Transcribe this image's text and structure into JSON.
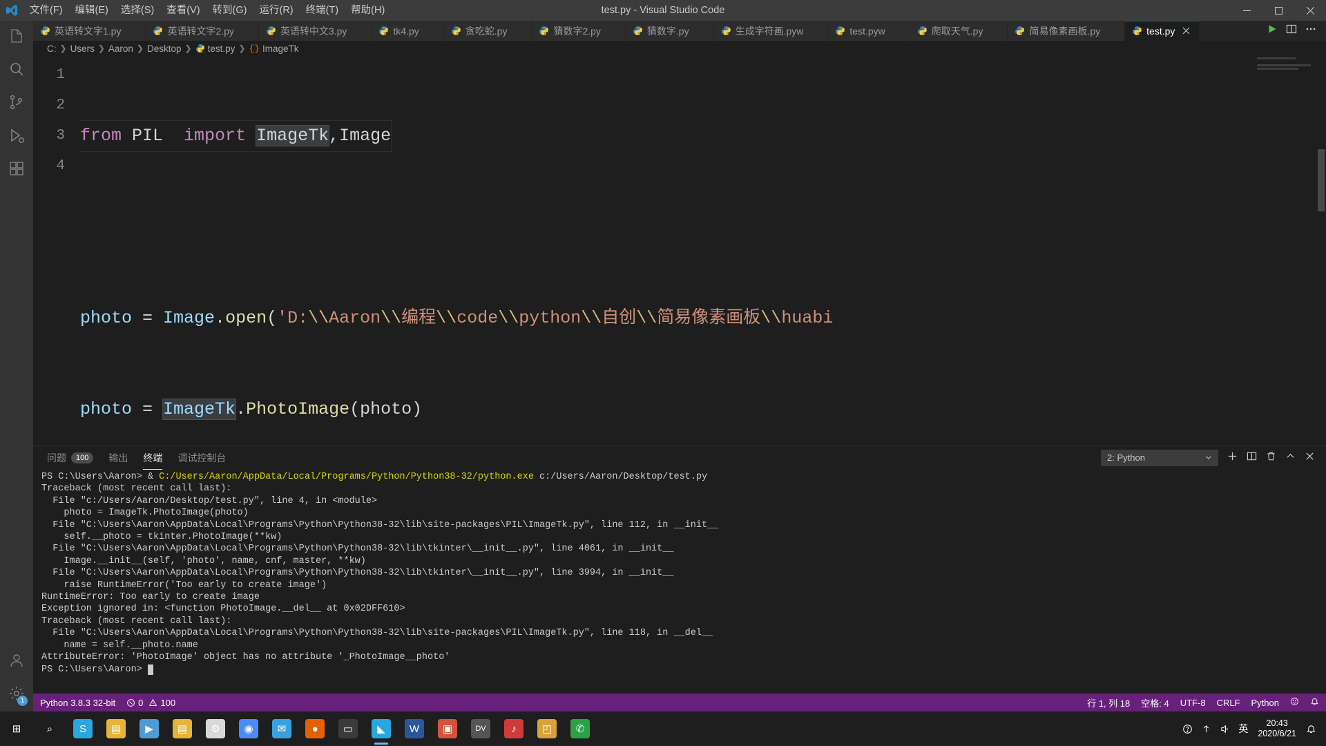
{
  "window": {
    "title": "test.py - Visual Studio Code",
    "controls": [
      "minimize",
      "maximize",
      "close"
    ]
  },
  "menu": [
    {
      "label": "文件(F)",
      "name": "menu-file"
    },
    {
      "label": "编辑(E)",
      "name": "menu-edit"
    },
    {
      "label": "选择(S)",
      "name": "menu-selection"
    },
    {
      "label": "查看(V)",
      "name": "menu-view"
    },
    {
      "label": "转到(G)",
      "name": "menu-go"
    },
    {
      "label": "运行(R)",
      "name": "menu-run"
    },
    {
      "label": "终端(T)",
      "name": "menu-terminal"
    },
    {
      "label": "帮助(H)",
      "name": "menu-help"
    }
  ],
  "activitybar": {
    "items": [
      {
        "name": "explorer",
        "icon": "files-icon",
        "active": false
      },
      {
        "name": "search",
        "icon": "search-icon",
        "active": false
      },
      {
        "name": "source-control",
        "icon": "source-control-icon",
        "active": false
      },
      {
        "name": "run-and-debug",
        "icon": "debug-icon",
        "active": false
      },
      {
        "name": "extensions",
        "icon": "extensions-icon",
        "active": false
      }
    ],
    "bottom": [
      {
        "name": "accounts",
        "icon": "account-icon",
        "badge": ""
      },
      {
        "name": "manage",
        "icon": "gear-icon",
        "badge": "1"
      }
    ]
  },
  "tabs": [
    {
      "label": "英语转文字1.py",
      "active": false
    },
    {
      "label": "英语转文字2.py",
      "active": false
    },
    {
      "label": "英语转中文3.py",
      "active": false
    },
    {
      "label": "tk4.py",
      "active": false
    },
    {
      "label": "贪吃蛇.py",
      "active": false
    },
    {
      "label": "猜数字2.py",
      "active": false
    },
    {
      "label": "猜数字.py",
      "active": false
    },
    {
      "label": "生成字符画.pyw",
      "active": false
    },
    {
      "label": "test.pyw",
      "active": false
    },
    {
      "label": "爬取天气.py",
      "active": false
    },
    {
      "label": "简易像素画板.py",
      "active": false
    },
    {
      "label": "test.py",
      "active": true
    }
  ],
  "tab_actions": [
    {
      "name": "run-python-file-button",
      "icon": "play-icon"
    },
    {
      "name": "split-editor-button",
      "icon": "split-icon"
    },
    {
      "name": "more-actions-button",
      "icon": "ellipsis-icon"
    }
  ],
  "breadcrumb": {
    "items": [
      "C:",
      "Users",
      "Aaron",
      "Desktop",
      "test.py",
      "ImageTk"
    ],
    "file_symbol": "{}"
  },
  "editor": {
    "line_numbers": [
      "1",
      "2",
      "3",
      "4"
    ],
    "lines": [
      "from PIL  import ImageTk,Image",
      "",
      "photo = Image.open('D:\\\\Aaron\\\\编程\\\\code\\\\python\\\\自创\\\\简易像素画板\\\\huabi",
      "photo = ImageTk.PhotoImage(photo)"
    ],
    "line1": {
      "kw_from": "from",
      "mod": " PIL  ",
      "kw_import": "import",
      "names_hl": "ImageTk",
      "names_rest": ",Image"
    },
    "line3": {
      "var": "photo",
      "eq": " = ",
      "obj": "Image",
      "dot": ".",
      "fn": "open",
      "paren": "(",
      "str_start": "'D:",
      "esc1": "\\\\",
      "p1": "Aaron",
      "esc2": "\\\\",
      "p2": "编程",
      "esc3": "\\\\",
      "p3": "code",
      "esc4": "\\\\",
      "p4": "python",
      "esc5": "\\\\",
      "p5": "自创",
      "esc6": "\\\\",
      "p6": "简易像素画板",
      "esc7": "\\\\",
      "p7": "huabi"
    },
    "line4": {
      "var": "photo",
      "eq": " = ",
      "obj_hl": "ImageTk",
      "dot": ".",
      "fn": "PhotoImage",
      "args": "(photo)"
    }
  },
  "panel": {
    "tabs": [
      {
        "label": "问题",
        "badge": "100",
        "active": false
      },
      {
        "label": "输出",
        "badge": "",
        "active": false
      },
      {
        "label": "终端",
        "badge": "",
        "active": true
      },
      {
        "label": "调试控制台",
        "badge": "",
        "active": false
      }
    ],
    "terminal_selector": "2: Python",
    "actions": [
      {
        "name": "new-terminal-button",
        "icon": "plus-icon"
      },
      {
        "name": "split-terminal-button",
        "icon": "split-icon"
      },
      {
        "name": "kill-terminal-button",
        "icon": "trash-icon"
      },
      {
        "name": "maximize-panel-button",
        "icon": "chevron-up-icon"
      },
      {
        "name": "close-panel-button",
        "icon": "close-icon"
      }
    ],
    "terminal_lines": [
      {
        "segments": [
          {
            "text": "PS C:\\Users\\Aaron> & ",
            "cls": ""
          },
          {
            "text": "C:/Users/Aaron/AppData/Local/Programs/Python/Python38-32/python.exe",
            "cls": "t-yellow"
          },
          {
            "text": " c:/Users/Aaron/Desktop/test.py",
            "cls": ""
          }
        ]
      },
      {
        "segments": [
          {
            "text": "Traceback (most recent call last):",
            "cls": ""
          }
        ]
      },
      {
        "segments": [
          {
            "text": "  File \"c:/Users/Aaron/Desktop/test.py\", line 4, in <module>",
            "cls": ""
          }
        ]
      },
      {
        "segments": [
          {
            "text": "    photo = ImageTk.PhotoImage(photo)",
            "cls": ""
          }
        ]
      },
      {
        "segments": [
          {
            "text": "  File \"C:\\Users\\Aaron\\AppData\\Local\\Programs\\Python\\Python38-32\\lib\\site-packages\\PIL\\ImageTk.py\", line 112, in __init__",
            "cls": ""
          }
        ]
      },
      {
        "segments": [
          {
            "text": "    self.__photo = tkinter.PhotoImage(**kw)",
            "cls": ""
          }
        ]
      },
      {
        "segments": [
          {
            "text": "  File \"C:\\Users\\Aaron\\AppData\\Local\\Programs\\Python\\Python38-32\\lib\\tkinter\\__init__.py\", line 4061, in __init__",
            "cls": ""
          }
        ]
      },
      {
        "segments": [
          {
            "text": "    Image.__init__(self, 'photo', name, cnf, master, **kw)",
            "cls": ""
          }
        ]
      },
      {
        "segments": [
          {
            "text": "  File \"C:\\Users\\Aaron\\AppData\\Local\\Programs\\Python\\Python38-32\\lib\\tkinter\\__init__.py\", line 3994, in __init__",
            "cls": ""
          }
        ]
      },
      {
        "segments": [
          {
            "text": "    raise RuntimeError('Too early to create image')",
            "cls": ""
          }
        ]
      },
      {
        "segments": [
          {
            "text": "RuntimeError: Too early to create image",
            "cls": ""
          }
        ]
      },
      {
        "segments": [
          {
            "text": "Exception ignored in: <function PhotoImage.__del__ at 0x02DFF610>",
            "cls": ""
          }
        ]
      },
      {
        "segments": [
          {
            "text": "Traceback (most recent call last):",
            "cls": ""
          }
        ]
      },
      {
        "segments": [
          {
            "text": "  File \"C:\\Users\\Aaron\\AppData\\Local\\Programs\\Python\\Python38-32\\lib\\site-packages\\PIL\\ImageTk.py\", line 118, in __del__",
            "cls": ""
          }
        ]
      },
      {
        "segments": [
          {
            "text": "    name = self.__photo.name",
            "cls": ""
          }
        ]
      },
      {
        "segments": [
          {
            "text": "AttributeError: 'PhotoImage' object has no attribute '_PhotoImage__photo'",
            "cls": ""
          }
        ]
      },
      {
        "segments": [
          {
            "text": "PS C:\\Users\\Aaron> ",
            "cls": ""
          },
          {
            "text": " ",
            "cls": "t-caret"
          }
        ]
      }
    ]
  },
  "statusbar": {
    "left": [
      {
        "name": "python-interpreter",
        "label": "Python 3.8.3 32-bit",
        "icon": ""
      },
      {
        "name": "problems-counts",
        "label": "0  100",
        "icon": "error-warning"
      }
    ],
    "right": [
      {
        "name": "cursor-position",
        "label": "行 1, 列 18"
      },
      {
        "name": "indentation",
        "label": "空格: 4"
      },
      {
        "name": "encoding",
        "label": "UTF-8"
      },
      {
        "name": "eol",
        "label": "CRLF"
      },
      {
        "name": "language-mode",
        "label": "Python"
      },
      {
        "name": "feedback",
        "label": "",
        "icon": "smiley-icon"
      },
      {
        "name": "notifications",
        "label": "",
        "icon": "bell-icon"
      }
    ]
  },
  "taskbar": {
    "buttons": [
      {
        "name": "start-button",
        "icon": "windows-icon",
        "color": "#ffffff",
        "glyph": "⊞"
      },
      {
        "name": "search-button",
        "icon": "search-icon",
        "color": "#ffffff",
        "glyph": "⌕"
      },
      {
        "name": "taskview-button",
        "icon": "task-view-icon",
        "color": "#2aa7e0",
        "glyph": "S"
      },
      {
        "name": "app-folder",
        "icon": "folder-icon",
        "color": "#e8b339",
        "glyph": "▤"
      },
      {
        "name": "app-player",
        "icon": "media-icon",
        "color": "#4d9cd6",
        "glyph": "▶"
      },
      {
        "name": "app-explorer",
        "icon": "explorer-icon",
        "color": "#e8b339",
        "glyph": "▤"
      },
      {
        "name": "app-settings",
        "icon": "gear-icon",
        "color": "#d9d9d9",
        "glyph": "⚙"
      },
      {
        "name": "app-chrome",
        "icon": "chrome-icon",
        "color": "#4a8cf7",
        "glyph": "◉"
      },
      {
        "name": "app-foxmail",
        "icon": "mail-icon",
        "color": "#3aa0e0",
        "glyph": "✉"
      },
      {
        "name": "app-firefox",
        "icon": "firefox-icon",
        "color": "#e66000",
        "glyph": "●"
      },
      {
        "name": "app-terminal",
        "icon": "terminal-icon",
        "color": "#3b3b3b",
        "glyph": "▭"
      },
      {
        "name": "app-vscode",
        "icon": "vscode-icon",
        "color": "#2aa7e0",
        "glyph": "◣"
      },
      {
        "name": "app-word",
        "icon": "word-icon",
        "color": "#2b579a",
        "glyph": "W"
      },
      {
        "name": "app-store",
        "icon": "store-icon",
        "color": "#d0553c",
        "glyph": "▣"
      },
      {
        "name": "app-dev",
        "icon": "devtool-icon",
        "color": "#555555",
        "glyph": "DV"
      },
      {
        "name": "app-music",
        "icon": "music-icon",
        "color": "#cf3b3b",
        "glyph": "♪"
      },
      {
        "name": "app-photos",
        "icon": "photos-icon",
        "color": "#d8a23a",
        "glyph": "◰"
      },
      {
        "name": "app-wechat",
        "icon": "wechat-icon",
        "color": "#2ba245",
        "glyph": "✆"
      }
    ],
    "tray": [
      {
        "name": "help-icon",
        "glyph": "?"
      },
      {
        "name": "updates-icon",
        "glyph": "↑"
      },
      {
        "name": "volume-icon",
        "glyph": "◁))"
      },
      {
        "name": "ime-indicator",
        "glyph": "英"
      }
    ],
    "clock": {
      "time": "20:43",
      "date": "2020/6/21"
    },
    "notification_icon": "bell-icon"
  }
}
